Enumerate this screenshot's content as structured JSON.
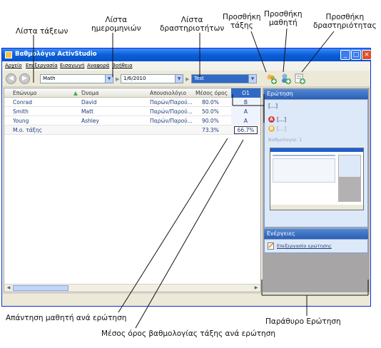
{
  "window": {
    "title": "Βαθμολόγιο ActivStudio",
    "menu": [
      "Αρχείο",
      "Επεξεργασία",
      "Εισαγωγή",
      "Αναφορά",
      "Βοήθεια"
    ]
  },
  "toolbar": {
    "class_value": "Math",
    "date_value": "1/6/2010",
    "activity_value": "Test"
  },
  "grid": {
    "headers": {
      "surname": "Επώνυμο",
      "name": "Όνομα",
      "attendance": "Απουσιολόγιο",
      "average": "Μέσος όρος",
      "question": "Ο1"
    },
    "rows": [
      {
        "surname": "Conrad",
        "name": "David",
        "attendance": "Παρών/Παρού...",
        "average": "80.0%",
        "answer": "B"
      },
      {
        "surname": "Smith",
        "name": "Matt",
        "attendance": "Παρών/Παρού...",
        "average": "50.0%",
        "answer": "A"
      },
      {
        "surname": "Young",
        "name": "Ashley",
        "attendance": "Παρών/Παρού...",
        "average": "90.0%",
        "answer": "A"
      }
    ],
    "summary": {
      "label": "Μ.ο. τάξης",
      "average": "73.3%",
      "question_average": "66.7%"
    }
  },
  "pane": {
    "question_header": "Ερώτηση",
    "question_text": "[...]",
    "option_a": "[...]",
    "option_b": "[...]",
    "correct_line": "Βαθμολογία: 1",
    "actions_header": "Ενέργειες",
    "action_edit": "Επεξεργασία ερώτησης"
  },
  "annotations": {
    "class_list": "Λίστα τάξεων",
    "date_list_1": "Λίστα",
    "date_list_2": "ημερομηνιών",
    "activity_list_1": "Λίστα",
    "activity_list_2": "δραστηριοτήτων",
    "add_class_1": "Προσθήκη",
    "add_class_2": "τάξης",
    "add_student_1": "Προσθήκη",
    "add_student_2": "μαθητή",
    "add_activity_1": "Προσθήκη",
    "add_activity_2": "δραστηριότητας",
    "student_answer": "Απάντηση μαθητή ανά ερώτηση",
    "question_window": "Παράθυρο Ερώτηση",
    "class_average": "Μέσος όρος βαθμολογίας τάξης ανά ερώτηση"
  },
  "colors": {
    "title_bar": "#0a5fd8",
    "selected_column": "#316ac5",
    "pane_background": "#a7a5a5"
  }
}
